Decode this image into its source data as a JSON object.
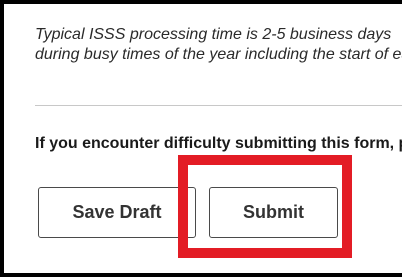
{
  "notice": {
    "line1": "Typical ISSS processing time is 2-5 business days",
    "line2": "during busy times of the year including the start of each semester"
  },
  "help": {
    "text": "If you encounter difficulty submitting this form, please contact ISSS"
  },
  "buttons": {
    "save_draft": "Save Draft",
    "submit": "Submit"
  },
  "colors": {
    "highlight": "#e31c25",
    "frame": "#000000",
    "divider": "#c8c8c8"
  }
}
